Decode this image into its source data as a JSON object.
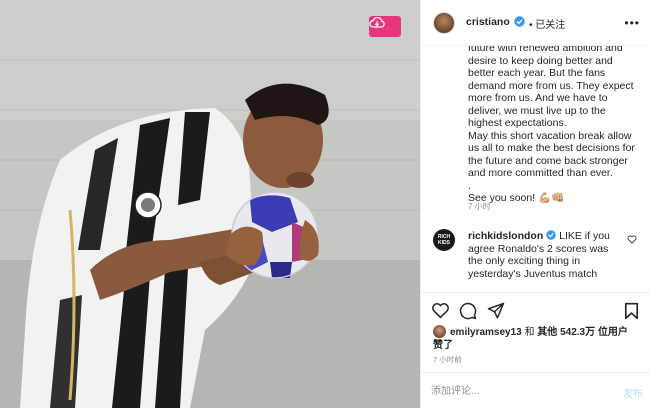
{
  "photo": {
    "alt_icon": "download-cloud-icon",
    "accent_color": "#e8367a"
  },
  "header": {
    "username": "cristiano",
    "dot": "•",
    "follow_status": "已关注",
    "more_icon": "•••"
  },
  "caption": {
    "text": "future with renewed ambition and desire to keep doing better and better each year. But the fans demand more from us. They expect more from us. And we have to deliver, we must live up to the highest expectations.\nMay this short vacation break allow us all to make the best decisions for the future and come back stronger and more committed than ever.\n.\nSee you soon! 💪🏼👊🏼",
    "time": "7 小时"
  },
  "comment": {
    "avatar_text": "RICH KIDS",
    "username": "richkidslondon",
    "text": " LIKE if you agree Ronaldo's 2 scores was the only exciting thing in yesterday's Juventus match"
  },
  "likes": {
    "user": "emilyramsey13",
    "middle": " 和 ",
    "others": "其他 542.3万 位用户",
    "suffix": "赞了"
  },
  "post_time": "7 小时前",
  "comment_box": {
    "placeholder": "添加评论...",
    "post_label": "发布"
  }
}
